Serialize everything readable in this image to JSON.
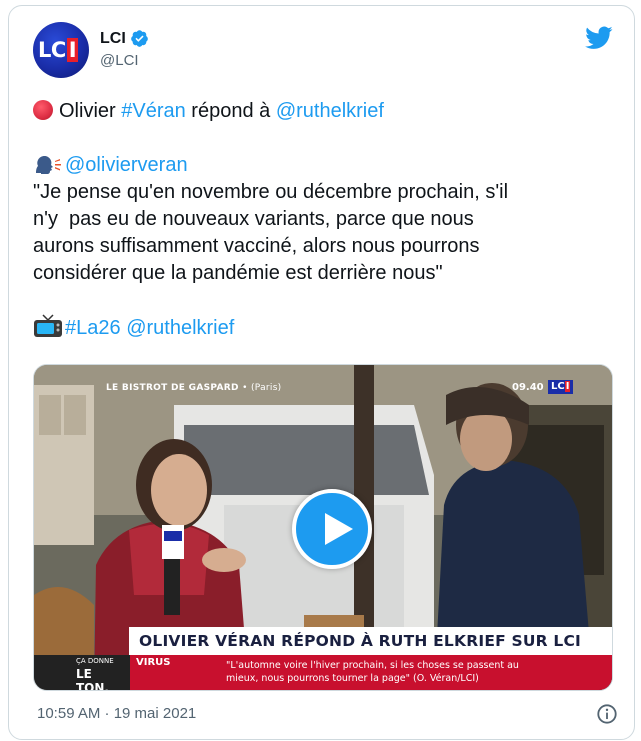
{
  "account": {
    "avatar_text": "LCI",
    "display_name": "LCI",
    "handle": "@LCI"
  },
  "tweet": {
    "line1": {
      "before": "Olivier ",
      "hashtag": "#Véran",
      "middle": " répond à ",
      "mention": "@ruthelkrief"
    },
    "line2_mention": "@olivierveran",
    "quote_lines": [
      "\"Je pense qu'en novembre ou décembre prochain, s'il",
      "n'y  pas eu de nouveaux variants, parce que nous",
      "aurons suffisamment vacciné, alors nous pourrons",
      "considérer que la pandémie est derrière nous\""
    ],
    "line_last": {
      "hashtag": "#La26",
      "mention": "@ruthelkrief"
    }
  },
  "video": {
    "location": "LE BISTROT DE GASPARD",
    "location_sub": "• (Paris)",
    "time": "09.40",
    "channel_logo": "LCI",
    "banner": "OLIVIER VÉRAN RÉPOND À RUTH ELKRIEF SUR LCI",
    "show_small": "ÇA DONNE",
    "show_big": "LE TON.",
    "category": "VIRUS",
    "quote_line1": "\"L'automne voire l'hiver prochain, si les choses se passent au",
    "quote_line2": "mieux, nous pourrons tourner la page\" (O. Véran/LCI)"
  },
  "meta": {
    "timestamp": "10:59 AM · 19 mai 2021"
  },
  "colors": {
    "link": "#1d9bf0",
    "text": "#0f1419",
    "secondary": "#536471",
    "border": "#cfd9de",
    "news_red": "#c8102e",
    "lci_blue": "#1a2da8"
  },
  "icons": [
    "red-circle-icon",
    "speaking-head-icon",
    "television-icon",
    "verified-badge-icon",
    "twitter-bird-icon",
    "play-icon",
    "info-icon"
  ]
}
